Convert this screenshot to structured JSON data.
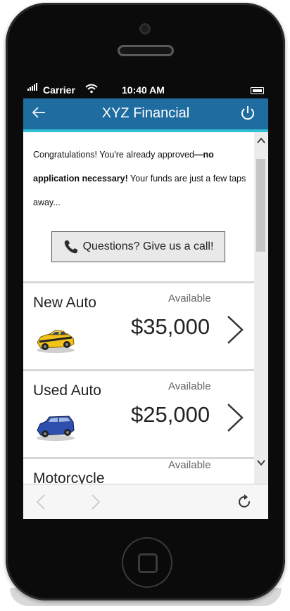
{
  "status_bar": {
    "carrier": "Carrier",
    "time": "10:40 AM"
  },
  "nav": {
    "title": "XYZ Financial",
    "back_icon": "arrow-left-icon",
    "power_icon": "power-icon",
    "bar_color": "#1f6ca0",
    "accent_color": "#31c0d8"
  },
  "intro": {
    "part1": "Congratulations! You're already approved",
    "bold": "—no application necessary!",
    "part2": " Your funds are just a few taps away..."
  },
  "call_button": {
    "label": "Questions? Give us a call!",
    "icon": "phone-icon"
  },
  "loans": [
    {
      "title": "New Auto",
      "available_label": "Available",
      "amount": "$35,000",
      "icon": "yellow-car-icon"
    },
    {
      "title": "Used Auto",
      "available_label": "Available",
      "amount": "$25,000",
      "icon": "blue-suv-icon"
    },
    {
      "title": "Motorcycle",
      "available_label": "Available"
    }
  ],
  "toolbar": {
    "back_icon": "browser-back-icon",
    "forward_icon": "browser-forward-icon",
    "reload_icon": "reload-icon"
  }
}
